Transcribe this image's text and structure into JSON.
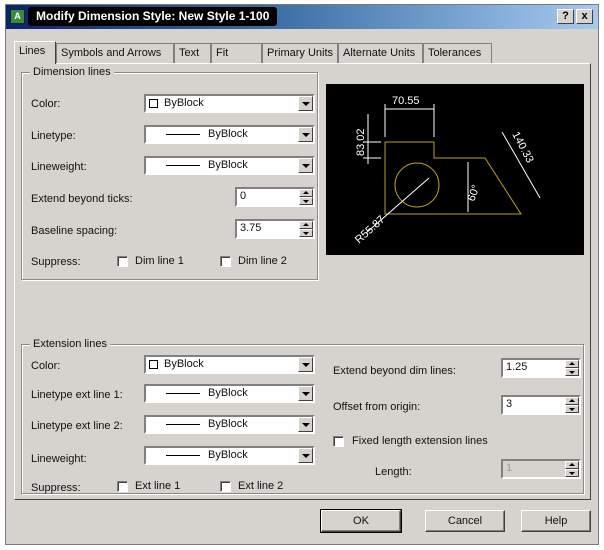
{
  "window": {
    "title": "Modify Dimension Style: New Style 1-100",
    "help_label": "?",
    "close_label": "x",
    "app_icon_glyph": "A"
  },
  "tabs": [
    {
      "label": "Lines",
      "active": true
    },
    {
      "label": "Symbols and Arrows",
      "active": false
    },
    {
      "label": "Text",
      "active": false
    },
    {
      "label": "Fit",
      "active": false
    },
    {
      "label": "Primary Units",
      "active": false
    },
    {
      "label": "Alternate Units",
      "active": false
    },
    {
      "label": "Tolerances",
      "active": false
    }
  ],
  "dimension_lines": {
    "legend": "Dimension lines",
    "color_label": "Color:",
    "color_value": "ByBlock",
    "linetype_label": "Linetype:",
    "linetype_value": "ByBlock",
    "lineweight_label": "Lineweight:",
    "lineweight_value": "ByBlock",
    "extend_label": "Extend beyond ticks:",
    "extend_value": "0",
    "baseline_label": "Baseline spacing:",
    "baseline_value": "3.75",
    "suppress_label": "Suppress:",
    "dim_line1_label": "Dim line 1",
    "dim_line2_label": "Dim line 2",
    "dim_line1_checked": false,
    "dim_line2_checked": false
  },
  "preview": {
    "dim_top": "70.55",
    "dim_left": "83.02",
    "dim_right": "140.33",
    "dim_angle": "60°",
    "dim_radius": "R55.87",
    "geometry_color": "#b8a020",
    "dim_color": "#ffffff"
  },
  "extension_lines": {
    "legend": "Extension lines",
    "color_label": "Color:",
    "color_value": "ByBlock",
    "linetype1_label": "Linetype ext line 1:",
    "linetype1_value": "ByBlock",
    "linetype2_label": "Linetype ext line 2:",
    "linetype2_value": "ByBlock",
    "lineweight_label": "Lineweight:",
    "lineweight_value": "ByBlock",
    "suppress_label": "Suppress:",
    "ext_line1_label": "Ext line 1",
    "ext_line2_label": "Ext line 2",
    "extend_label": "Extend beyond dim lines:",
    "extend_value": "1.25",
    "offset_label": "Offset from origin:",
    "offset_value": "3",
    "fixed_length_label": "Fixed length extension lines",
    "fixed_length_checked": false,
    "length_label": "Length:",
    "length_value": "1"
  },
  "buttons": {
    "ok": "OK",
    "cancel": "Cancel",
    "help": "Help"
  }
}
